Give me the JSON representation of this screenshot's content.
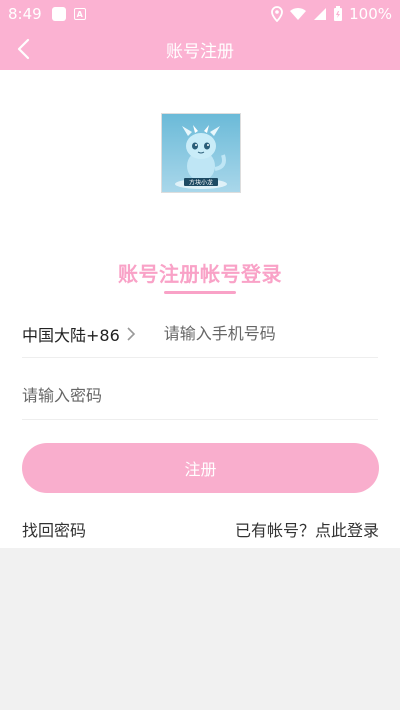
{
  "status_bar": {
    "time": "8:49",
    "battery": "100%",
    "a_icon_letter": "A"
  },
  "nav": {
    "title": "账号注册"
  },
  "logo": {
    "caption": "方块小龙"
  },
  "form": {
    "heading": "账号注册帐号登录",
    "region_code": "中国大陆+86",
    "phone_placeholder": "请输入手机号码",
    "password_placeholder": "请输入密码",
    "register_label": "注册"
  },
  "links": {
    "forgot_password": "找回密码",
    "have_account": "已有帐号？点此登录"
  },
  "colors": {
    "brand_pink": "#fbb2d2",
    "heading_pink": "#f9a2c7",
    "button_pink": "#f9aecd"
  }
}
